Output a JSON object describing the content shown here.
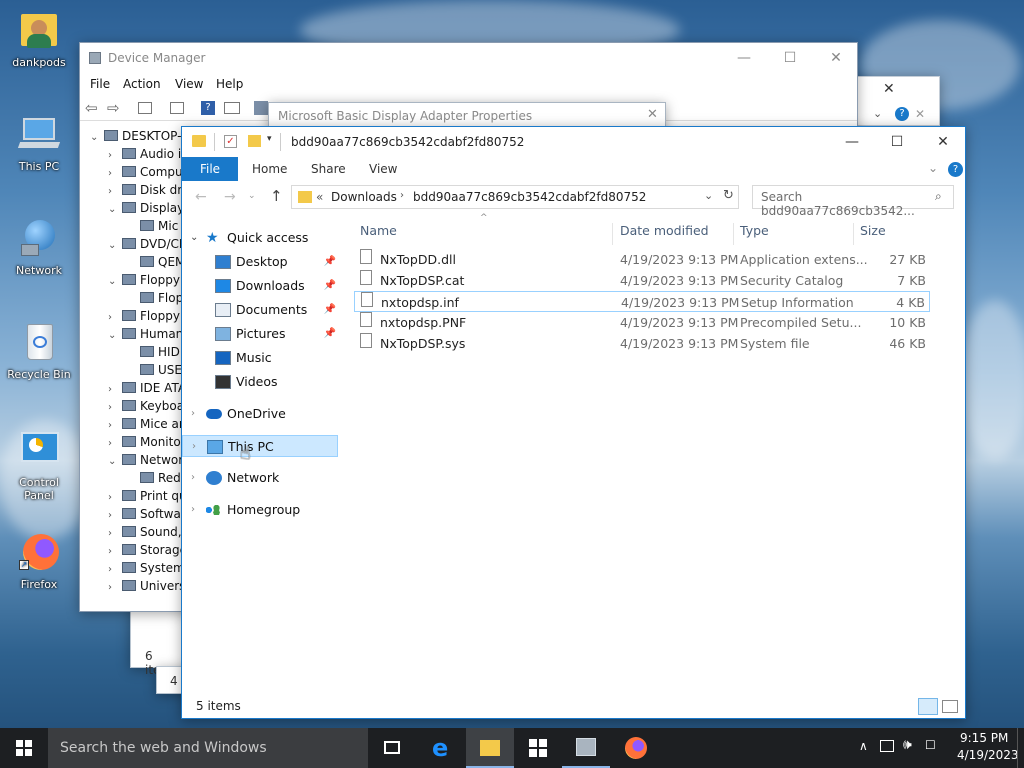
{
  "desktop": {
    "icons": [
      {
        "label": "dankpods",
        "icon": "user-folder-icon"
      },
      {
        "label": "This PC",
        "icon": "computer-icon"
      },
      {
        "label": "Network",
        "icon": "network-icon"
      },
      {
        "label": "Recycle Bin",
        "icon": "recycle-bin-icon"
      },
      {
        "label": "Control Panel",
        "icon": "control-panel-icon"
      },
      {
        "label": "Firefox",
        "icon": "firefox-icon"
      }
    ]
  },
  "device_manager": {
    "title": "Device Manager",
    "menu": [
      "File",
      "Action",
      "View",
      "Help"
    ],
    "tree": [
      {
        "label": "DESKTOP-I",
        "expanded": true
      },
      {
        "label": "Audio i"
      },
      {
        "label": "Compu"
      },
      {
        "label": "Disk dri"
      },
      {
        "label": "Display",
        "expanded": true
      },
      {
        "label": "Mic"
      },
      {
        "label": "DVD/CI",
        "expanded": true
      },
      {
        "label": "QEM"
      },
      {
        "label": "Floppy",
        "expanded": true
      },
      {
        "label": "Flop"
      },
      {
        "label": "Floppy"
      },
      {
        "label": "Human",
        "expanded": true
      },
      {
        "label": "HID"
      },
      {
        "label": "USE"
      },
      {
        "label": "IDE ATA"
      },
      {
        "label": "Keyboa"
      },
      {
        "label": "Mice ar"
      },
      {
        "label": "Monito"
      },
      {
        "label": "Networ",
        "expanded": true
      },
      {
        "label": "Red"
      },
      {
        "label": "Print qu"
      },
      {
        "label": "Softwa"
      },
      {
        "label": "Sound,"
      },
      {
        "label": "Storage"
      },
      {
        "label": "System"
      },
      {
        "label": "Univers"
      }
    ]
  },
  "properties_dialog": {
    "title": "Microsoft Basic Display Adapter Properties"
  },
  "background_status": {
    "items_a": "6 items",
    "items_b": "4 i"
  },
  "explorer": {
    "title": "bdd90aa77c869cb3542cdabf2fd80752",
    "ribbon_tabs": [
      "File",
      "Home",
      "Share",
      "View"
    ],
    "address": {
      "prefix": "«",
      "crumb1": "Downloads",
      "crumb2": "bdd90aa77c869cb3542cdabf2fd80752"
    },
    "search_placeholder": "Search bdd90aa77c869cb3542...",
    "nav": {
      "quick_access": "Quick access",
      "items": [
        "Desktop",
        "Downloads",
        "Documents",
        "Pictures",
        "Music",
        "Videos"
      ],
      "onedrive": "OneDrive",
      "this_pc": "This PC",
      "network": "Network",
      "homegroup": "Homegroup"
    },
    "columns": {
      "name": "Name",
      "date": "Date modified",
      "type": "Type",
      "size": "Size"
    },
    "files": [
      {
        "name": "NxTopDD.dll",
        "date": "4/19/2023 9:13 PM",
        "type": "Application extens...",
        "size": "27 KB"
      },
      {
        "name": "NxTopDSP.cat",
        "date": "4/19/2023 9:13 PM",
        "type": "Security Catalog",
        "size": "7 KB"
      },
      {
        "name": "nxtopdsp.inf",
        "date": "4/19/2023 9:13 PM",
        "type": "Setup Information",
        "size": "4 KB"
      },
      {
        "name": "nxtopdsp.PNF",
        "date": "4/19/2023 9:13 PM",
        "type": "Precompiled Setu...",
        "size": "10 KB"
      },
      {
        "name": "NxTopDSP.sys",
        "date": "4/19/2023 9:13 PM",
        "type": "System file",
        "size": "46 KB"
      }
    ],
    "status": "5 items"
  },
  "taskbar": {
    "search_placeholder": "Search the web and Windows",
    "clock_time": "9:15 PM",
    "clock_date": "4/19/2023"
  },
  "colors": {
    "accent": "#1979ca",
    "selection": "#cce8ff",
    "hover": "#e5f3ff",
    "taskbar": "#1d1f22"
  }
}
